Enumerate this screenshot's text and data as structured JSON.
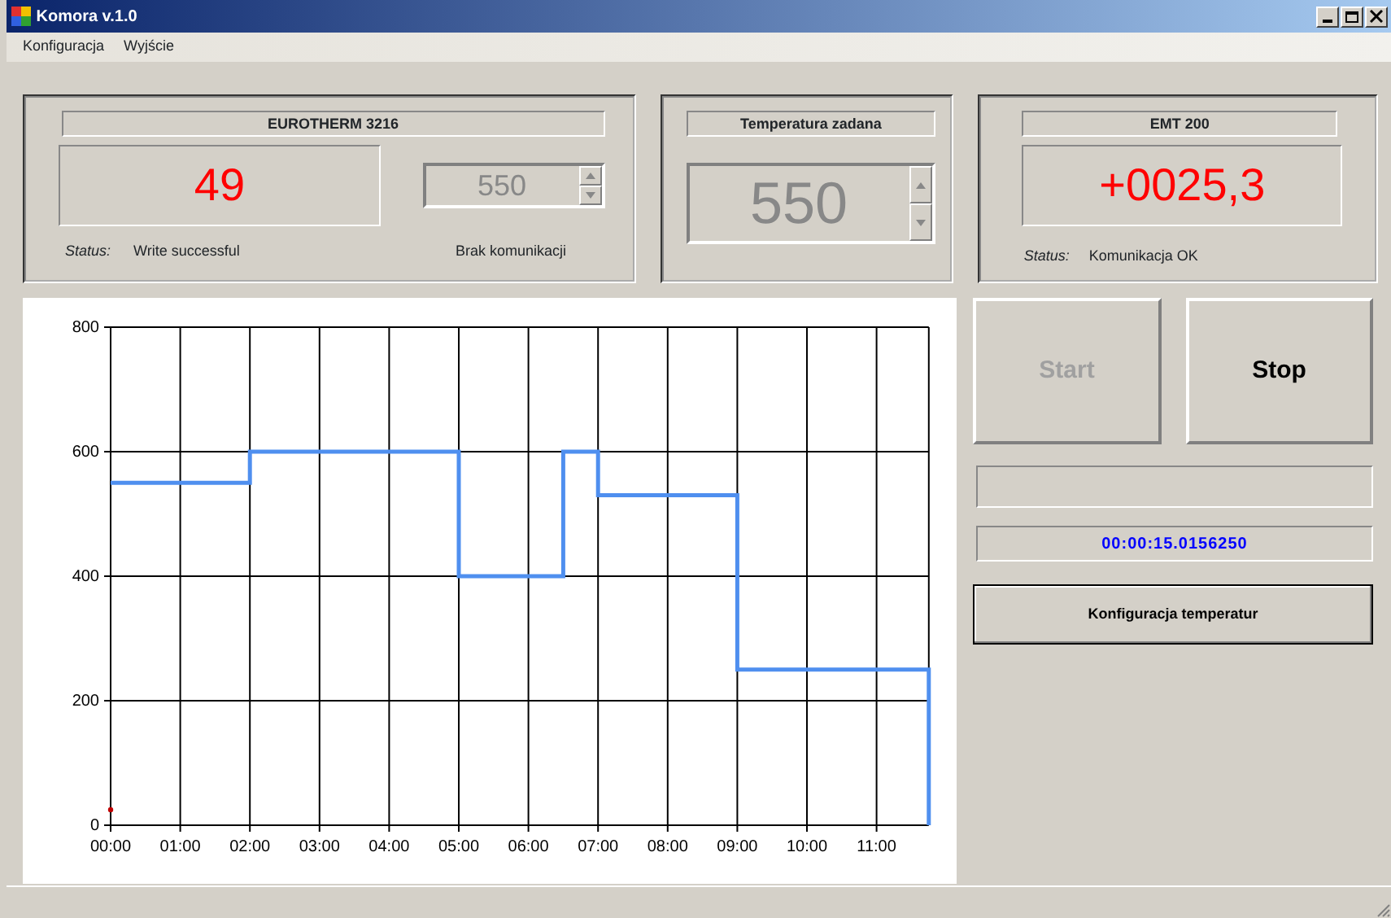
{
  "window": {
    "title": "Komora v.1.0"
  },
  "menu": [
    "Konfiguracja",
    "Wyjście"
  ],
  "eurotherm": {
    "title": "EUROTHERM 3216",
    "reading": "49",
    "setpoint": {
      "value": "550",
      "disabled": true
    },
    "status_label": "Status:",
    "status": "Write successful",
    "comm": "Brak komunikacji"
  },
  "setpoint": {
    "title": "Temperatura zadana",
    "value": "550",
    "disabled": true
  },
  "emt": {
    "title": "EMT 200",
    "reading": "+0025,3",
    "status_label": "Status:",
    "status": "Komunikacja OK"
  },
  "buttons": [
    {
      "label": "Start",
      "disabled": true
    },
    {
      "label": "Stop",
      "disabled": false
    }
  ],
  "timer": "00:00:15.0156250",
  "config_button": "Konfiguracja temperatur",
  "chart": {
    "chart_data": {
      "type": "line",
      "x": [
        0,
        2,
        2,
        5,
        5,
        6.5,
        6.5,
        7,
        7,
        9,
        9,
        11.75,
        11.75
      ],
      "series": [
        {
          "color": "#4f8fef",
          "values": [
            550,
            550,
            600,
            600,
            400,
            400,
            600,
            600,
            530,
            530,
            250,
            250,
            0
          ]
        },
        {
          "color": "#c00000",
          "marker": "circle",
          "values": [
            25,
            null,
            null,
            null,
            null,
            null,
            null,
            null,
            null,
            null,
            null,
            null,
            null
          ]
        }
      ],
      "grid": true,
      "xlim": [
        0,
        11.75
      ],
      "ylim": [
        0,
        800
      ],
      "xticks": [
        {
          "value": 0,
          "label": "00:00"
        },
        {
          "value": 1,
          "label": "01:00"
        },
        {
          "value": 2,
          "label": "02:00"
        },
        {
          "value": 3,
          "label": "03:00"
        },
        {
          "value": 4,
          "label": "04:00"
        },
        {
          "value": 5,
          "label": "05:00"
        },
        {
          "value": 6,
          "label": "06:00"
        },
        {
          "value": 7,
          "label": "07:00"
        },
        {
          "value": 8,
          "label": "08:00"
        },
        {
          "value": 9,
          "label": "09:00"
        },
        {
          "value": 10,
          "label": "10:00"
        },
        {
          "value": 11,
          "label": "11:00"
        }
      ],
      "yticks": [
        0,
        200,
        400,
        600,
        800
      ]
    }
  }
}
